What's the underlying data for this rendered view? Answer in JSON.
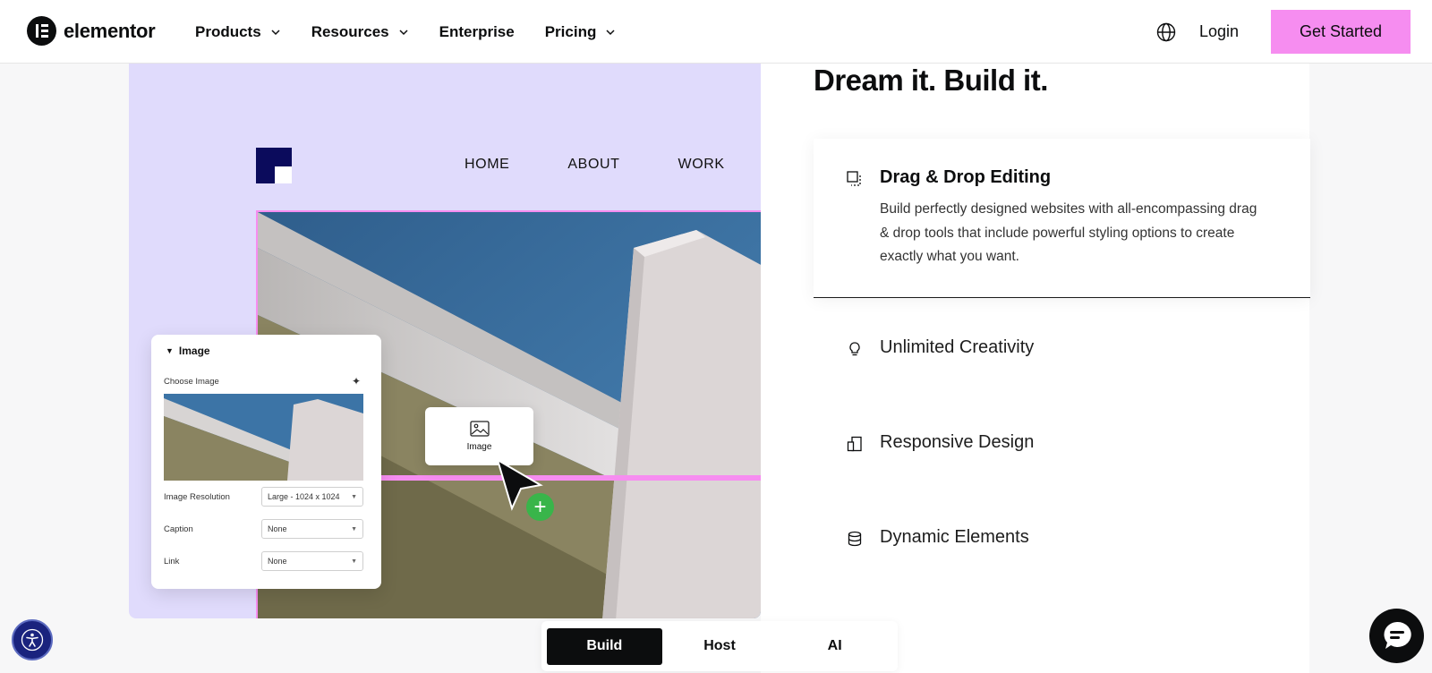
{
  "header": {
    "brand": "elementor",
    "nav": [
      {
        "label": "Products",
        "has_menu": true
      },
      {
        "label": "Resources",
        "has_menu": true
      },
      {
        "label": "Enterprise",
        "has_menu": false
      },
      {
        "label": "Pricing",
        "has_menu": true
      }
    ],
    "login_label": "Login",
    "cta_label": "Get Started"
  },
  "showcase": {
    "site_nav": [
      "HOME",
      "ABOUT",
      "WORK"
    ],
    "panel": {
      "title": "Image",
      "choose_label": "Choose Image",
      "fields": [
        {
          "label": "Image Resolution",
          "value": "Large - 1024 x 1024"
        },
        {
          "label": "Caption",
          "value": "None"
        },
        {
          "label": "Link",
          "value": "None"
        }
      ]
    },
    "widget_label": "Image"
  },
  "features": {
    "headline": "Dream it. Build it.",
    "active": {
      "title": "Drag & Drop Editing",
      "description": "Build perfectly designed websites with all-encompassing drag & drop tools that include powerful styling options to create exactly what you want.",
      "icon": "drag-drop-icon"
    },
    "items": [
      {
        "title": "Unlimited Creativity",
        "icon": "lightbulb-icon"
      },
      {
        "title": "Responsive Design",
        "icon": "devices-icon"
      },
      {
        "title": "Dynamic Elements",
        "icon": "database-icon"
      }
    ]
  },
  "tabs": [
    {
      "label": "Build",
      "active": true
    },
    {
      "label": "Host",
      "active": false
    },
    {
      "label": "AI",
      "active": false
    }
  ],
  "colors": {
    "accent": "#f68df0",
    "showcase_bg": "#e0dbfc",
    "dark": "#0c0d0e",
    "success": "#39b54a"
  }
}
